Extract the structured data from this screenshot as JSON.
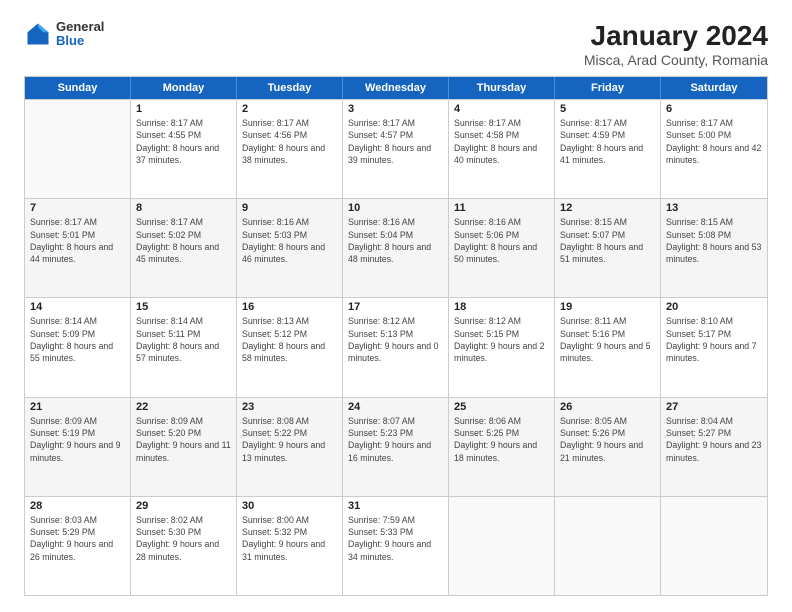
{
  "header": {
    "logo_general": "General",
    "logo_blue": "Blue",
    "title": "January 2024",
    "subtitle": "Misca, Arad County, Romania"
  },
  "days_of_week": [
    "Sunday",
    "Monday",
    "Tuesday",
    "Wednesday",
    "Thursday",
    "Friday",
    "Saturday"
  ],
  "weeks": [
    [
      {
        "day": "",
        "sunrise": "",
        "sunset": "",
        "daylight": ""
      },
      {
        "day": "1",
        "sunrise": "Sunrise: 8:17 AM",
        "sunset": "Sunset: 4:55 PM",
        "daylight": "Daylight: 8 hours and 37 minutes."
      },
      {
        "day": "2",
        "sunrise": "Sunrise: 8:17 AM",
        "sunset": "Sunset: 4:56 PM",
        "daylight": "Daylight: 8 hours and 38 minutes."
      },
      {
        "day": "3",
        "sunrise": "Sunrise: 8:17 AM",
        "sunset": "Sunset: 4:57 PM",
        "daylight": "Daylight: 8 hours and 39 minutes."
      },
      {
        "day": "4",
        "sunrise": "Sunrise: 8:17 AM",
        "sunset": "Sunset: 4:58 PM",
        "daylight": "Daylight: 8 hours and 40 minutes."
      },
      {
        "day": "5",
        "sunrise": "Sunrise: 8:17 AM",
        "sunset": "Sunset: 4:59 PM",
        "daylight": "Daylight: 8 hours and 41 minutes."
      },
      {
        "day": "6",
        "sunrise": "Sunrise: 8:17 AM",
        "sunset": "Sunset: 5:00 PM",
        "daylight": "Daylight: 8 hours and 42 minutes."
      }
    ],
    [
      {
        "day": "7",
        "sunrise": "Sunrise: 8:17 AM",
        "sunset": "Sunset: 5:01 PM",
        "daylight": "Daylight: 8 hours and 44 minutes."
      },
      {
        "day": "8",
        "sunrise": "Sunrise: 8:17 AM",
        "sunset": "Sunset: 5:02 PM",
        "daylight": "Daylight: 8 hours and 45 minutes."
      },
      {
        "day": "9",
        "sunrise": "Sunrise: 8:16 AM",
        "sunset": "Sunset: 5:03 PM",
        "daylight": "Daylight: 8 hours and 46 minutes."
      },
      {
        "day": "10",
        "sunrise": "Sunrise: 8:16 AM",
        "sunset": "Sunset: 5:04 PM",
        "daylight": "Daylight: 8 hours and 48 minutes."
      },
      {
        "day": "11",
        "sunrise": "Sunrise: 8:16 AM",
        "sunset": "Sunset: 5:06 PM",
        "daylight": "Daylight: 8 hours and 50 minutes."
      },
      {
        "day": "12",
        "sunrise": "Sunrise: 8:15 AM",
        "sunset": "Sunset: 5:07 PM",
        "daylight": "Daylight: 8 hours and 51 minutes."
      },
      {
        "day": "13",
        "sunrise": "Sunrise: 8:15 AM",
        "sunset": "Sunset: 5:08 PM",
        "daylight": "Daylight: 8 hours and 53 minutes."
      }
    ],
    [
      {
        "day": "14",
        "sunrise": "Sunrise: 8:14 AM",
        "sunset": "Sunset: 5:09 PM",
        "daylight": "Daylight: 8 hours and 55 minutes."
      },
      {
        "day": "15",
        "sunrise": "Sunrise: 8:14 AM",
        "sunset": "Sunset: 5:11 PM",
        "daylight": "Daylight: 8 hours and 57 minutes."
      },
      {
        "day": "16",
        "sunrise": "Sunrise: 8:13 AM",
        "sunset": "Sunset: 5:12 PM",
        "daylight": "Daylight: 8 hours and 58 minutes."
      },
      {
        "day": "17",
        "sunrise": "Sunrise: 8:12 AM",
        "sunset": "Sunset: 5:13 PM",
        "daylight": "Daylight: 9 hours and 0 minutes."
      },
      {
        "day": "18",
        "sunrise": "Sunrise: 8:12 AM",
        "sunset": "Sunset: 5:15 PM",
        "daylight": "Daylight: 9 hours and 2 minutes."
      },
      {
        "day": "19",
        "sunrise": "Sunrise: 8:11 AM",
        "sunset": "Sunset: 5:16 PM",
        "daylight": "Daylight: 9 hours and 5 minutes."
      },
      {
        "day": "20",
        "sunrise": "Sunrise: 8:10 AM",
        "sunset": "Sunset: 5:17 PM",
        "daylight": "Daylight: 9 hours and 7 minutes."
      }
    ],
    [
      {
        "day": "21",
        "sunrise": "Sunrise: 8:09 AM",
        "sunset": "Sunset: 5:19 PM",
        "daylight": "Daylight: 9 hours and 9 minutes."
      },
      {
        "day": "22",
        "sunrise": "Sunrise: 8:09 AM",
        "sunset": "Sunset: 5:20 PM",
        "daylight": "Daylight: 9 hours and 11 minutes."
      },
      {
        "day": "23",
        "sunrise": "Sunrise: 8:08 AM",
        "sunset": "Sunset: 5:22 PM",
        "daylight": "Daylight: 9 hours and 13 minutes."
      },
      {
        "day": "24",
        "sunrise": "Sunrise: 8:07 AM",
        "sunset": "Sunset: 5:23 PM",
        "daylight": "Daylight: 9 hours and 16 minutes."
      },
      {
        "day": "25",
        "sunrise": "Sunrise: 8:06 AM",
        "sunset": "Sunset: 5:25 PM",
        "daylight": "Daylight: 9 hours and 18 minutes."
      },
      {
        "day": "26",
        "sunrise": "Sunrise: 8:05 AM",
        "sunset": "Sunset: 5:26 PM",
        "daylight": "Daylight: 9 hours and 21 minutes."
      },
      {
        "day": "27",
        "sunrise": "Sunrise: 8:04 AM",
        "sunset": "Sunset: 5:27 PM",
        "daylight": "Daylight: 9 hours and 23 minutes."
      }
    ],
    [
      {
        "day": "28",
        "sunrise": "Sunrise: 8:03 AM",
        "sunset": "Sunset: 5:29 PM",
        "daylight": "Daylight: 9 hours and 26 minutes."
      },
      {
        "day": "29",
        "sunrise": "Sunrise: 8:02 AM",
        "sunset": "Sunset: 5:30 PM",
        "daylight": "Daylight: 9 hours and 28 minutes."
      },
      {
        "day": "30",
        "sunrise": "Sunrise: 8:00 AM",
        "sunset": "Sunset: 5:32 PM",
        "daylight": "Daylight: 9 hours and 31 minutes."
      },
      {
        "day": "31",
        "sunrise": "Sunrise: 7:59 AM",
        "sunset": "Sunset: 5:33 PM",
        "daylight": "Daylight: 9 hours and 34 minutes."
      },
      {
        "day": "",
        "sunrise": "",
        "sunset": "",
        "daylight": ""
      },
      {
        "day": "",
        "sunrise": "",
        "sunset": "",
        "daylight": ""
      },
      {
        "day": "",
        "sunrise": "",
        "sunset": "",
        "daylight": ""
      }
    ]
  ]
}
